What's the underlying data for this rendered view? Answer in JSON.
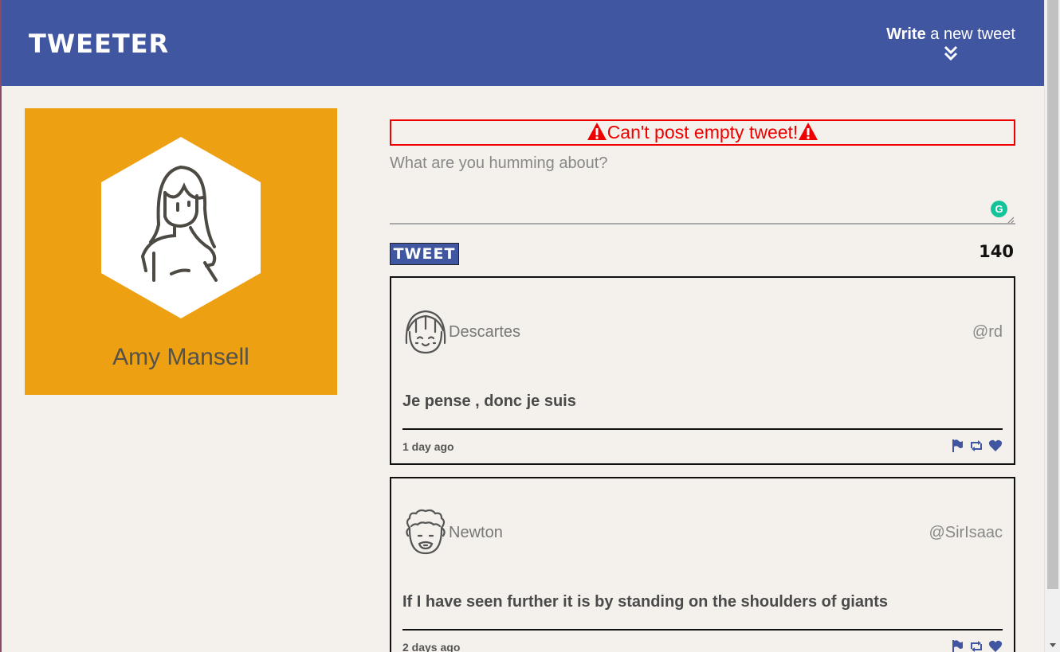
{
  "nav": {
    "brand": "TWEETER",
    "compose_bold": "Write",
    "compose_rest": " a new tweet"
  },
  "profile": {
    "name": "Amy Mansell",
    "accent": "#eea013"
  },
  "composer": {
    "error": "Can't post empty tweet!",
    "placeholder": "What are you humming about?",
    "tweet_button": "TWEET",
    "counter": "140"
  },
  "tweets": [
    {
      "name": "Descartes",
      "handle": "@rd",
      "body": "Je pense , donc je suis",
      "time": "1 day ago",
      "avatar": "girl-face-icon"
    },
    {
      "name": "Newton",
      "handle": "@SirIsaac",
      "body": "If I have seen further it is by standing on the shoulders of giants",
      "time": "2 days ago",
      "avatar": "curly-hair-face-icon"
    }
  ],
  "colors": {
    "nav": "#4056a1",
    "error": "#ee0000",
    "background": "#f4f1ec"
  }
}
